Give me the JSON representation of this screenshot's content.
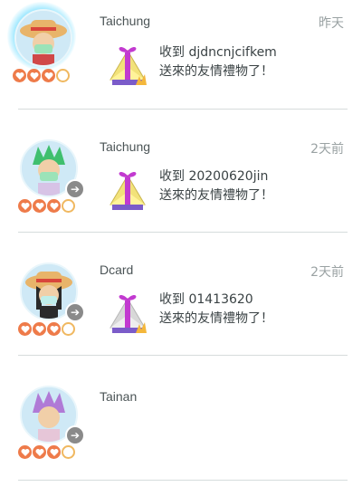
{
  "friends": [
    {
      "name": "Taichung",
      "time": "昨天",
      "line1": "收到 djdncnjcifkem",
      "line2": "送來的友情禮物了！",
      "has_gift": true,
      "avatar": "straw-hat-masked"
    },
    {
      "name": "Taichung",
      "time": "2天前",
      "line1": "收到 20200620jin",
      "line2": "送來的友情禮物了！",
      "has_gift": true,
      "avatar": "green-hair"
    },
    {
      "name": "Dcard",
      "time": "2天前",
      "line1": "收到 01413620",
      "line2": "送來的友情禮物了！",
      "has_gift": true,
      "avatar": "straw-hat-masked-dark"
    },
    {
      "name": "Tainan",
      "time": "",
      "line1": "",
      "line2": "",
      "has_gift": false,
      "avatar": "purple-hair"
    }
  ],
  "colors": {
    "heart": "#ee7b4a",
    "gift_ribbon": "#c23ad0",
    "gift_box": "#f2e27a"
  }
}
